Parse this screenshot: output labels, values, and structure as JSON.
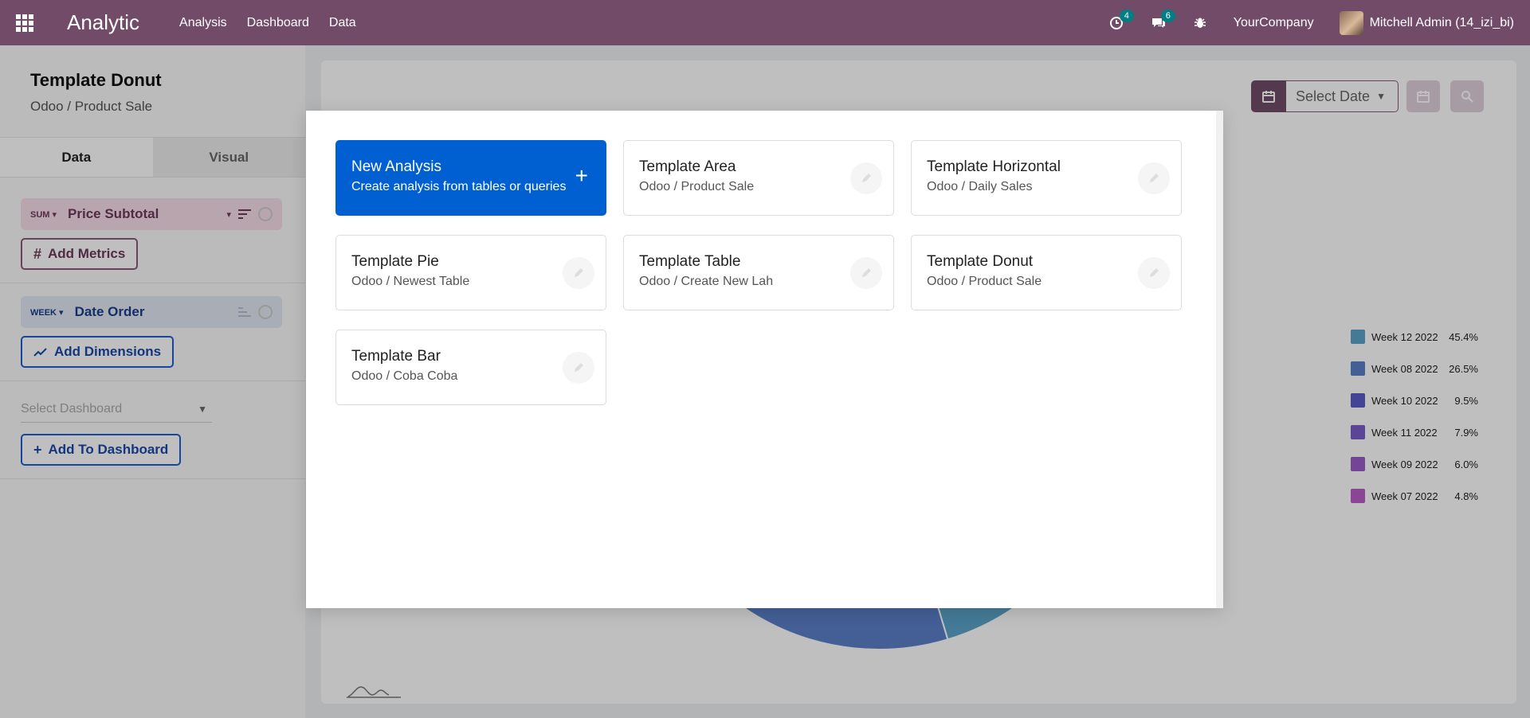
{
  "navbar": {
    "app_name": "Analytic",
    "menu": [
      "Analysis",
      "Dashboard",
      "Data"
    ],
    "activity_count": "4",
    "messages_count": "6",
    "company": "YourCompany",
    "user": "Mitchell Admin (14_izi_bi)"
  },
  "analysis": {
    "title": "Template Donut",
    "subtitle": "Odoo / Product Sale",
    "tabs": [
      "Data",
      "Visual"
    ],
    "metric": {
      "aggregation": "SUM",
      "field": "Price Subtotal"
    },
    "add_metrics_label": "Add Metrics",
    "dimension": {
      "granularity": "WEEK",
      "field": "Date Order"
    },
    "add_dimensions_label": "Add Dimensions",
    "dashboard_placeholder": "Select Dashboard",
    "add_to_dashboard_label": "Add To Dashboard"
  },
  "chart_controls": {
    "date_placeholder": "Select Date"
  },
  "chart_data": {
    "type": "pie",
    "title": "",
    "categories": [
      "Week 12 2022",
      "Week 08 2022",
      "Week 10 2022",
      "Week 11 2022",
      "Week 09 2022",
      "Week 07 2022"
    ],
    "values": [
      45.4,
      26.5,
      9.5,
      7.9,
      6.0,
      4.8
    ],
    "value_labels": [
      "45.4%",
      "26.5%",
      "9.5%",
      "7.9%",
      "6.0%",
      "4.8%"
    ],
    "colors": [
      "#5ba3c9",
      "#5b7fc9",
      "#5b5bc9",
      "#7b5bc9",
      "#9b5bc9",
      "#bb5bc9"
    ],
    "legend_position": "right"
  },
  "modal": {
    "cards": [
      {
        "title": "New Analysis",
        "subtitle": "Create analysis from tables or queries"
      },
      {
        "title": "Template Area",
        "subtitle": "Odoo / Product Sale"
      },
      {
        "title": "Template Horizontal",
        "subtitle": "Odoo / Daily Sales"
      },
      {
        "title": "Template Pie",
        "subtitle": "Odoo / Newest Table"
      },
      {
        "title": "Template Table",
        "subtitle": "Odoo / Create New Lah"
      },
      {
        "title": "Template Donut",
        "subtitle": "Odoo / Product Sale"
      },
      {
        "title": "Template Bar",
        "subtitle": "Odoo / Coba Coba"
      }
    ]
  },
  "colors": {
    "navbar": "#714b67",
    "primary": "#0060d1",
    "badge": "#017e84"
  }
}
